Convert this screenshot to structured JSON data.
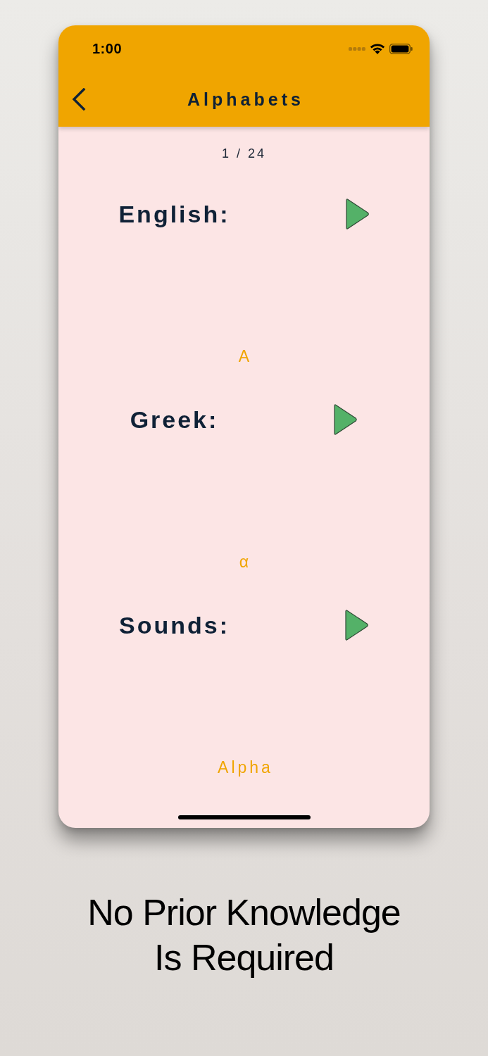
{
  "status_bar": {
    "time": "1:00"
  },
  "nav": {
    "title": "Alphabets"
  },
  "counter": "1 / 24",
  "sections": [
    {
      "label": "English:",
      "value": "A"
    },
    {
      "label": "Greek:",
      "value": "α"
    },
    {
      "label": "Sounds:",
      "value": "Alpha"
    }
  ],
  "caption": "No Prior Knowledge Is Required"
}
